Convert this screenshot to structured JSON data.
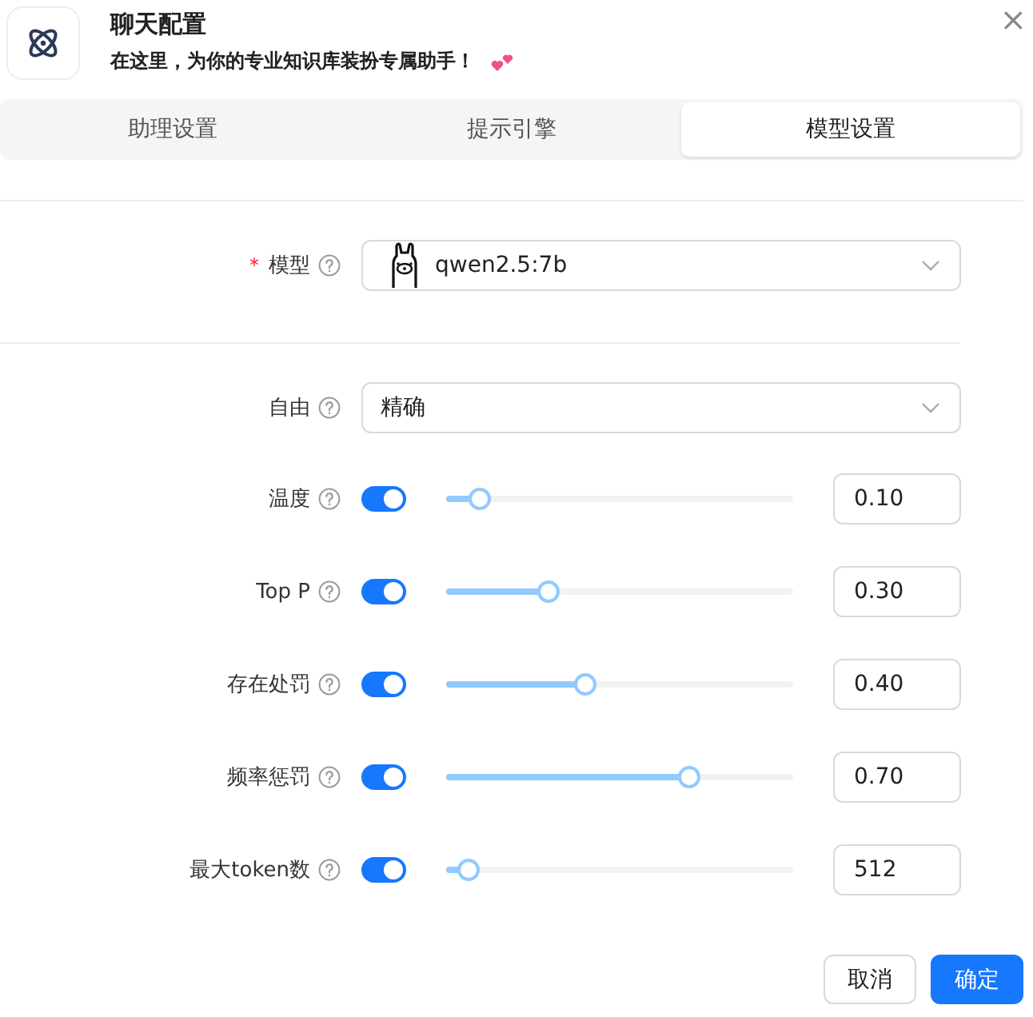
{
  "dialog": {
    "title": "聊天配置",
    "subtitle": "在这里，为你的专业知识库装扮专属助手！",
    "close": "×"
  },
  "tabs": [
    {
      "label": "助理设置",
      "selected": false
    },
    {
      "label": "提示引擎",
      "selected": false
    },
    {
      "label": "模型设置",
      "selected": true
    }
  ],
  "model": {
    "required_mark": "*",
    "label": "模型",
    "value": "qwen2.5:7b"
  },
  "mode": {
    "label": "自由",
    "value": "精确"
  },
  "params": [
    {
      "label": "温度",
      "enabled": true,
      "level": 0.097,
      "value": "0.10"
    },
    {
      "label": "Top P",
      "enabled": true,
      "level": 0.295,
      "value": "0.30"
    },
    {
      "label": "存在处罚",
      "enabled": true,
      "level": 0.4,
      "value": "0.40"
    },
    {
      "label": "频率惩罚",
      "enabled": true,
      "level": 0.7,
      "value": "0.70"
    },
    {
      "label": "最大token数",
      "enabled": true,
      "level": 0.065,
      "value": "512"
    }
  ],
  "buttons": [
    {
      "label": "取消",
      "kind": "secondary"
    },
    {
      "label": "确定",
      "kind": "primary"
    }
  ]
}
